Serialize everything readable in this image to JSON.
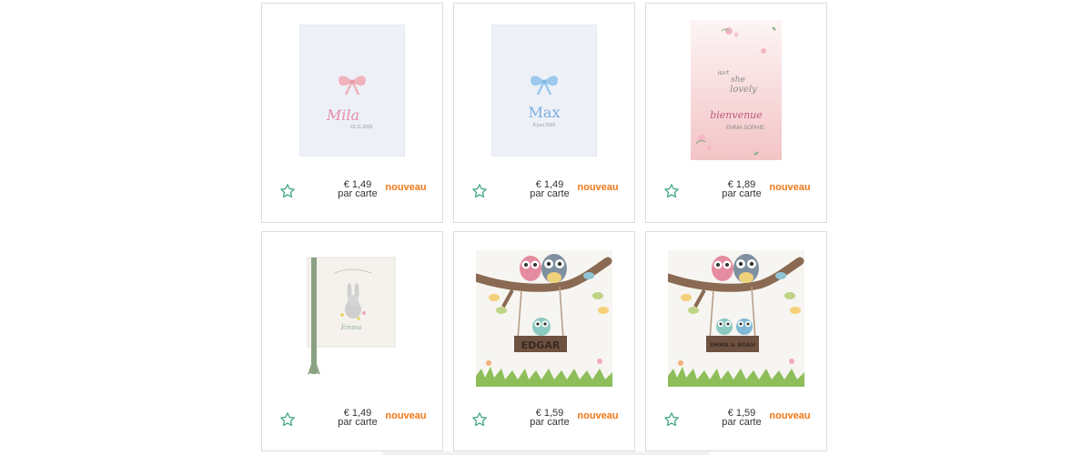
{
  "accent_color": "#f07818",
  "star_color": "#4aa98f",
  "products": [
    {
      "price": "€ 1,49",
      "unit": "par carte",
      "badge": "nouveau",
      "card_name": "Mila",
      "card_date": "19.11.2025",
      "design": "pink-bow"
    },
    {
      "price": "€ 1,49",
      "unit": "par carte",
      "badge": "nouveau",
      "card_name": "Max",
      "card_date": "8 juni 2025",
      "design": "blue-bow"
    },
    {
      "price": "€ 1,89",
      "unit": "par carte",
      "badge": "nouveau",
      "card_line1": "isn't",
      "card_line2": "she",
      "card_line3": "lovely",
      "card_welcome": "bienvenue",
      "card_name": "EMMA SOPHIE",
      "design": "pink-floral"
    },
    {
      "price": "€ 1,49",
      "unit": "par carte",
      "badge": "nouveau",
      "card_name": "Emma",
      "design": "bunny-ribbon"
    },
    {
      "price": "€ 1,59",
      "unit": "par carte",
      "badge": "nouveau",
      "card_name": "EDGAR",
      "design": "owls-swing"
    },
    {
      "price": "€ 1,59",
      "unit": "par carte",
      "badge": "nouveau",
      "card_name": "EMMA & NOAH",
      "design": "owls-swing-twins"
    }
  ]
}
